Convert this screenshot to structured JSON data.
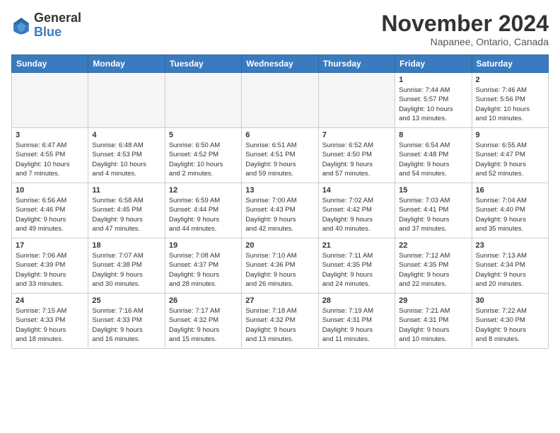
{
  "header": {
    "logo_general": "General",
    "logo_blue": "Blue",
    "month": "November 2024",
    "location": "Napanee, Ontario, Canada"
  },
  "weekdays": [
    "Sunday",
    "Monday",
    "Tuesday",
    "Wednesday",
    "Thursday",
    "Friday",
    "Saturday"
  ],
  "weeks": [
    [
      {
        "day": "",
        "info": ""
      },
      {
        "day": "",
        "info": ""
      },
      {
        "day": "",
        "info": ""
      },
      {
        "day": "",
        "info": ""
      },
      {
        "day": "",
        "info": ""
      },
      {
        "day": "1",
        "info": "Sunrise: 7:44 AM\nSunset: 5:57 PM\nDaylight: 10 hours\nand 13 minutes."
      },
      {
        "day": "2",
        "info": "Sunrise: 7:46 AM\nSunset: 5:56 PM\nDaylight: 10 hours\nand 10 minutes."
      }
    ],
    [
      {
        "day": "3",
        "info": "Sunrise: 6:47 AM\nSunset: 4:55 PM\nDaylight: 10 hours\nand 7 minutes."
      },
      {
        "day": "4",
        "info": "Sunrise: 6:48 AM\nSunset: 4:53 PM\nDaylight: 10 hours\nand 4 minutes."
      },
      {
        "day": "5",
        "info": "Sunrise: 6:50 AM\nSunset: 4:52 PM\nDaylight: 10 hours\nand 2 minutes."
      },
      {
        "day": "6",
        "info": "Sunrise: 6:51 AM\nSunset: 4:51 PM\nDaylight: 9 hours\nand 59 minutes."
      },
      {
        "day": "7",
        "info": "Sunrise: 6:52 AM\nSunset: 4:50 PM\nDaylight: 9 hours\nand 57 minutes."
      },
      {
        "day": "8",
        "info": "Sunrise: 6:54 AM\nSunset: 4:48 PM\nDaylight: 9 hours\nand 54 minutes."
      },
      {
        "day": "9",
        "info": "Sunrise: 6:55 AM\nSunset: 4:47 PM\nDaylight: 9 hours\nand 52 minutes."
      }
    ],
    [
      {
        "day": "10",
        "info": "Sunrise: 6:56 AM\nSunset: 4:46 PM\nDaylight: 9 hours\nand 49 minutes."
      },
      {
        "day": "11",
        "info": "Sunrise: 6:58 AM\nSunset: 4:45 PM\nDaylight: 9 hours\nand 47 minutes."
      },
      {
        "day": "12",
        "info": "Sunrise: 6:59 AM\nSunset: 4:44 PM\nDaylight: 9 hours\nand 44 minutes."
      },
      {
        "day": "13",
        "info": "Sunrise: 7:00 AM\nSunset: 4:43 PM\nDaylight: 9 hours\nand 42 minutes."
      },
      {
        "day": "14",
        "info": "Sunrise: 7:02 AM\nSunset: 4:42 PM\nDaylight: 9 hours\nand 40 minutes."
      },
      {
        "day": "15",
        "info": "Sunrise: 7:03 AM\nSunset: 4:41 PM\nDaylight: 9 hours\nand 37 minutes."
      },
      {
        "day": "16",
        "info": "Sunrise: 7:04 AM\nSunset: 4:40 PM\nDaylight: 9 hours\nand 35 minutes."
      }
    ],
    [
      {
        "day": "17",
        "info": "Sunrise: 7:06 AM\nSunset: 4:39 PM\nDaylight: 9 hours\nand 33 minutes."
      },
      {
        "day": "18",
        "info": "Sunrise: 7:07 AM\nSunset: 4:38 PM\nDaylight: 9 hours\nand 30 minutes."
      },
      {
        "day": "19",
        "info": "Sunrise: 7:08 AM\nSunset: 4:37 PM\nDaylight: 9 hours\nand 28 minutes."
      },
      {
        "day": "20",
        "info": "Sunrise: 7:10 AM\nSunset: 4:36 PM\nDaylight: 9 hours\nand 26 minutes."
      },
      {
        "day": "21",
        "info": "Sunrise: 7:11 AM\nSunset: 4:35 PM\nDaylight: 9 hours\nand 24 minutes."
      },
      {
        "day": "22",
        "info": "Sunrise: 7:12 AM\nSunset: 4:35 PM\nDaylight: 9 hours\nand 22 minutes."
      },
      {
        "day": "23",
        "info": "Sunrise: 7:13 AM\nSunset: 4:34 PM\nDaylight: 9 hours\nand 20 minutes."
      }
    ],
    [
      {
        "day": "24",
        "info": "Sunrise: 7:15 AM\nSunset: 4:33 PM\nDaylight: 9 hours\nand 18 minutes."
      },
      {
        "day": "25",
        "info": "Sunrise: 7:16 AM\nSunset: 4:33 PM\nDaylight: 9 hours\nand 16 minutes."
      },
      {
        "day": "26",
        "info": "Sunrise: 7:17 AM\nSunset: 4:32 PM\nDaylight: 9 hours\nand 15 minutes."
      },
      {
        "day": "27",
        "info": "Sunrise: 7:18 AM\nSunset: 4:32 PM\nDaylight: 9 hours\nand 13 minutes."
      },
      {
        "day": "28",
        "info": "Sunrise: 7:19 AM\nSunset: 4:31 PM\nDaylight: 9 hours\nand 11 minutes."
      },
      {
        "day": "29",
        "info": "Sunrise: 7:21 AM\nSunset: 4:31 PM\nDaylight: 9 hours\nand 10 minutes."
      },
      {
        "day": "30",
        "info": "Sunrise: 7:22 AM\nSunset: 4:30 PM\nDaylight: 9 hours\nand 8 minutes."
      }
    ]
  ]
}
